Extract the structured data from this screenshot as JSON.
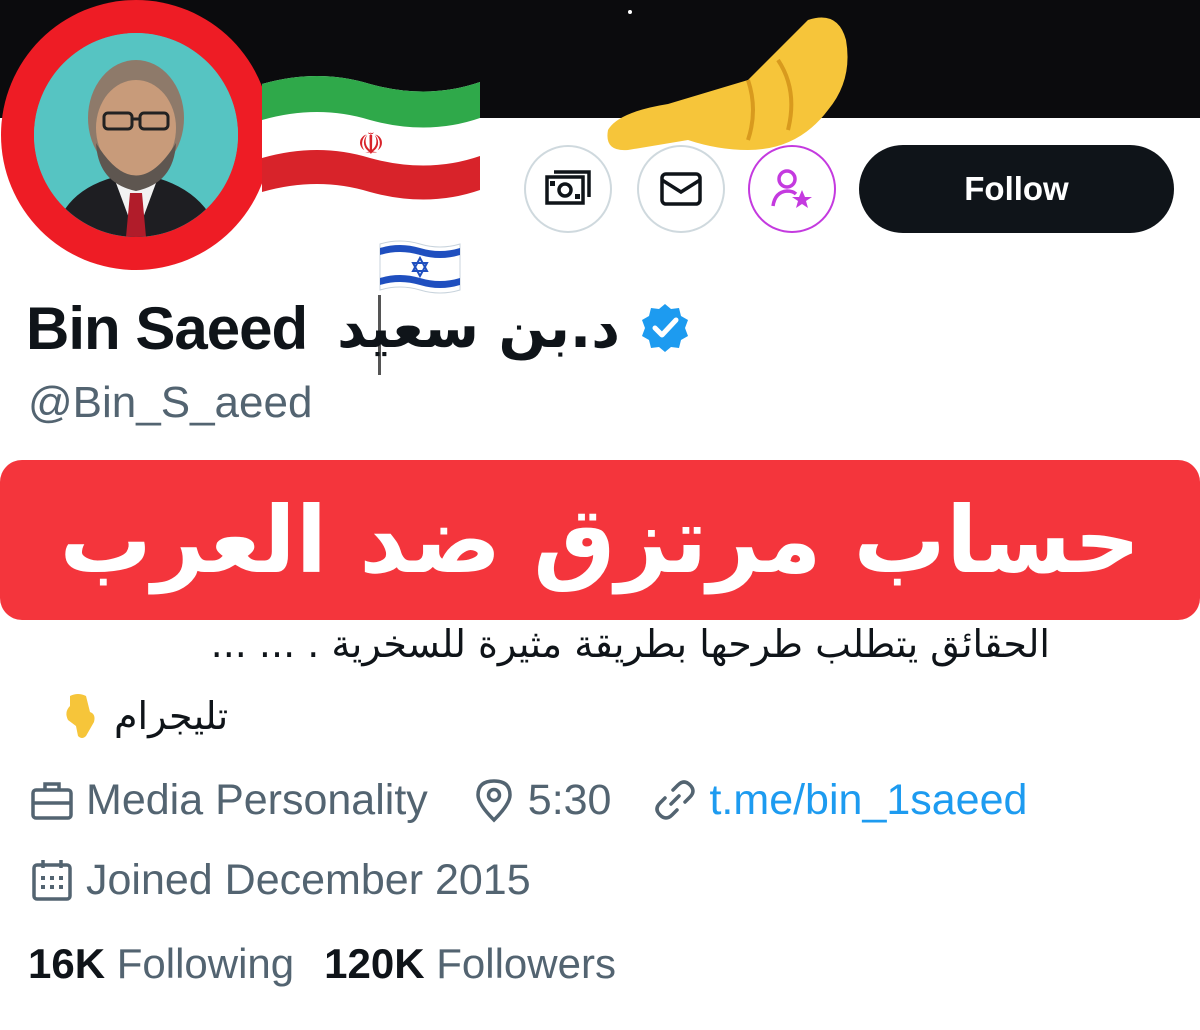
{
  "header": {
    "follow_label": "Follow",
    "actions": [
      {
        "name": "tip-icon"
      },
      {
        "name": "message-icon"
      },
      {
        "name": "subscribe-icon"
      }
    ]
  },
  "profile": {
    "name_latin": "Bin Saeed",
    "name_arabic": "د.بن سعيد",
    "handle": "@Bin_S_aeed",
    "verified": true
  },
  "overlay": {
    "banner_text": "حساب مرتزق ضد العرب",
    "banner_color": "#f4353c"
  },
  "bio": {
    "line1": "الحقائق يتطلب طرحها بطريقة مثيرة للسخرية . ... ...",
    "line2": "تليجرام"
  },
  "meta": {
    "category": "Media Personality",
    "location": "5:30",
    "link": "t.me/bin_1saeed",
    "joined": "Joined December 2015"
  },
  "stats": {
    "following_count": "16K",
    "following_label": "Following",
    "followers_count": "120K",
    "followers_label": "Followers"
  },
  "colors": {
    "accent": "#1d9bf0",
    "secondary_text": "#536471",
    "follow_button": "#0f1419",
    "avatar_ring": "#ee1c25"
  }
}
